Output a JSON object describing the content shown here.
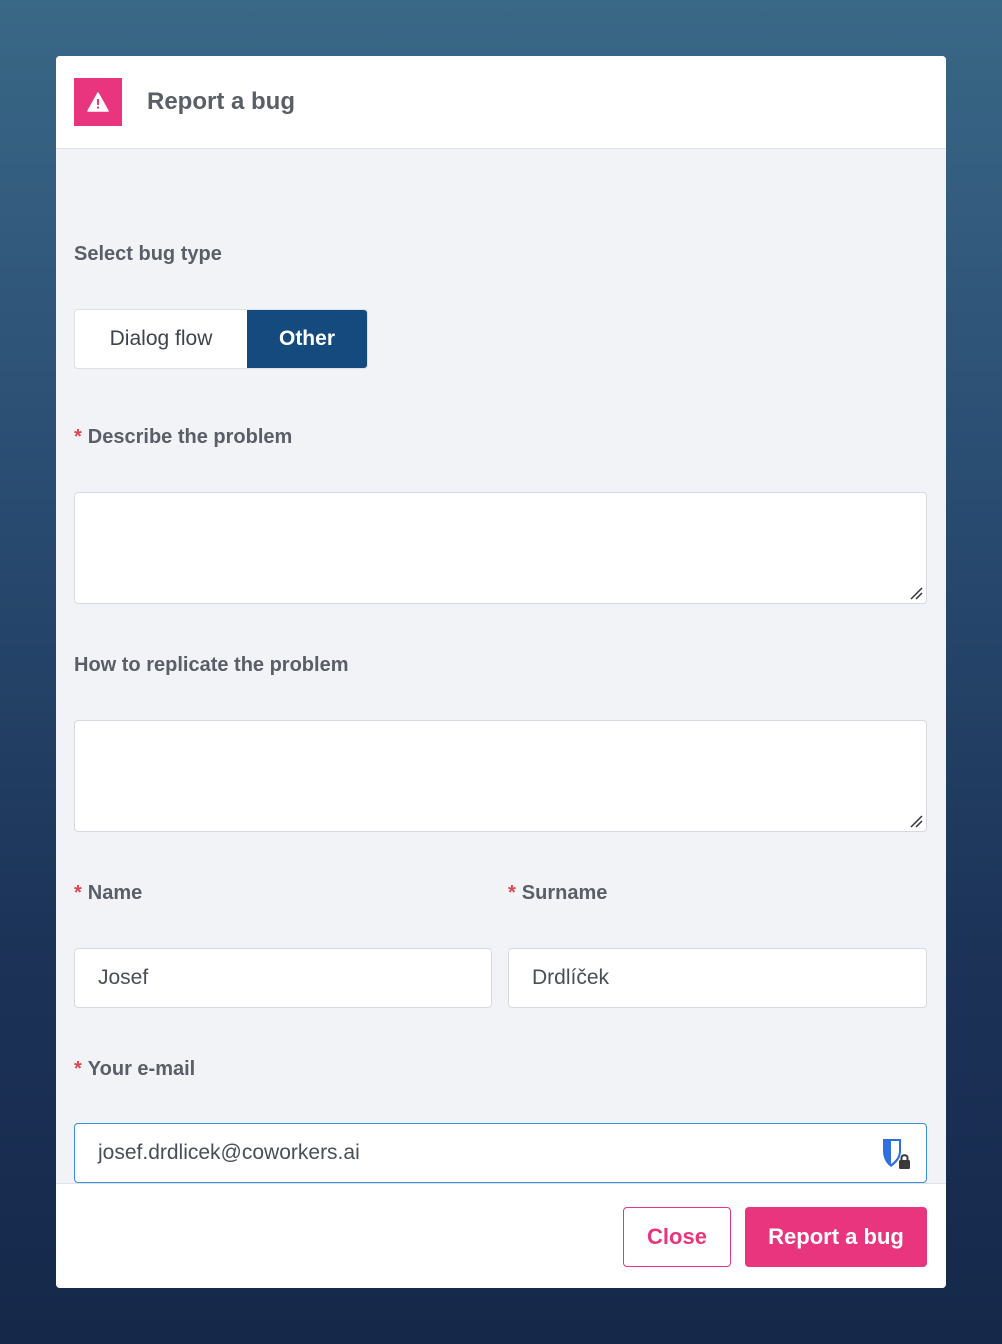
{
  "header": {
    "title": "Report a bug",
    "icon": "warning-icon",
    "accent_color": "#e8357e"
  },
  "bug_type": {
    "label": "Select bug type",
    "options": [
      "Dialog flow",
      "Other"
    ],
    "selected": "Other",
    "selected_color": "#144a7d"
  },
  "describe": {
    "required_mark": "*",
    "label": "Describe the problem",
    "value": ""
  },
  "replicate": {
    "label": "How to replicate the problem",
    "value": ""
  },
  "name": {
    "required_mark": "*",
    "label": "Name",
    "value": "Josef"
  },
  "surname": {
    "required_mark": "*",
    "label": "Surname",
    "value": "Drdlíček"
  },
  "email": {
    "required_mark": "*",
    "label": "Your e-mail",
    "value": "josef.drdlicek@coworkers.ai",
    "icon": "password-manager-icon"
  },
  "footer": {
    "close_label": "Close",
    "submit_label": "Report a bug"
  }
}
